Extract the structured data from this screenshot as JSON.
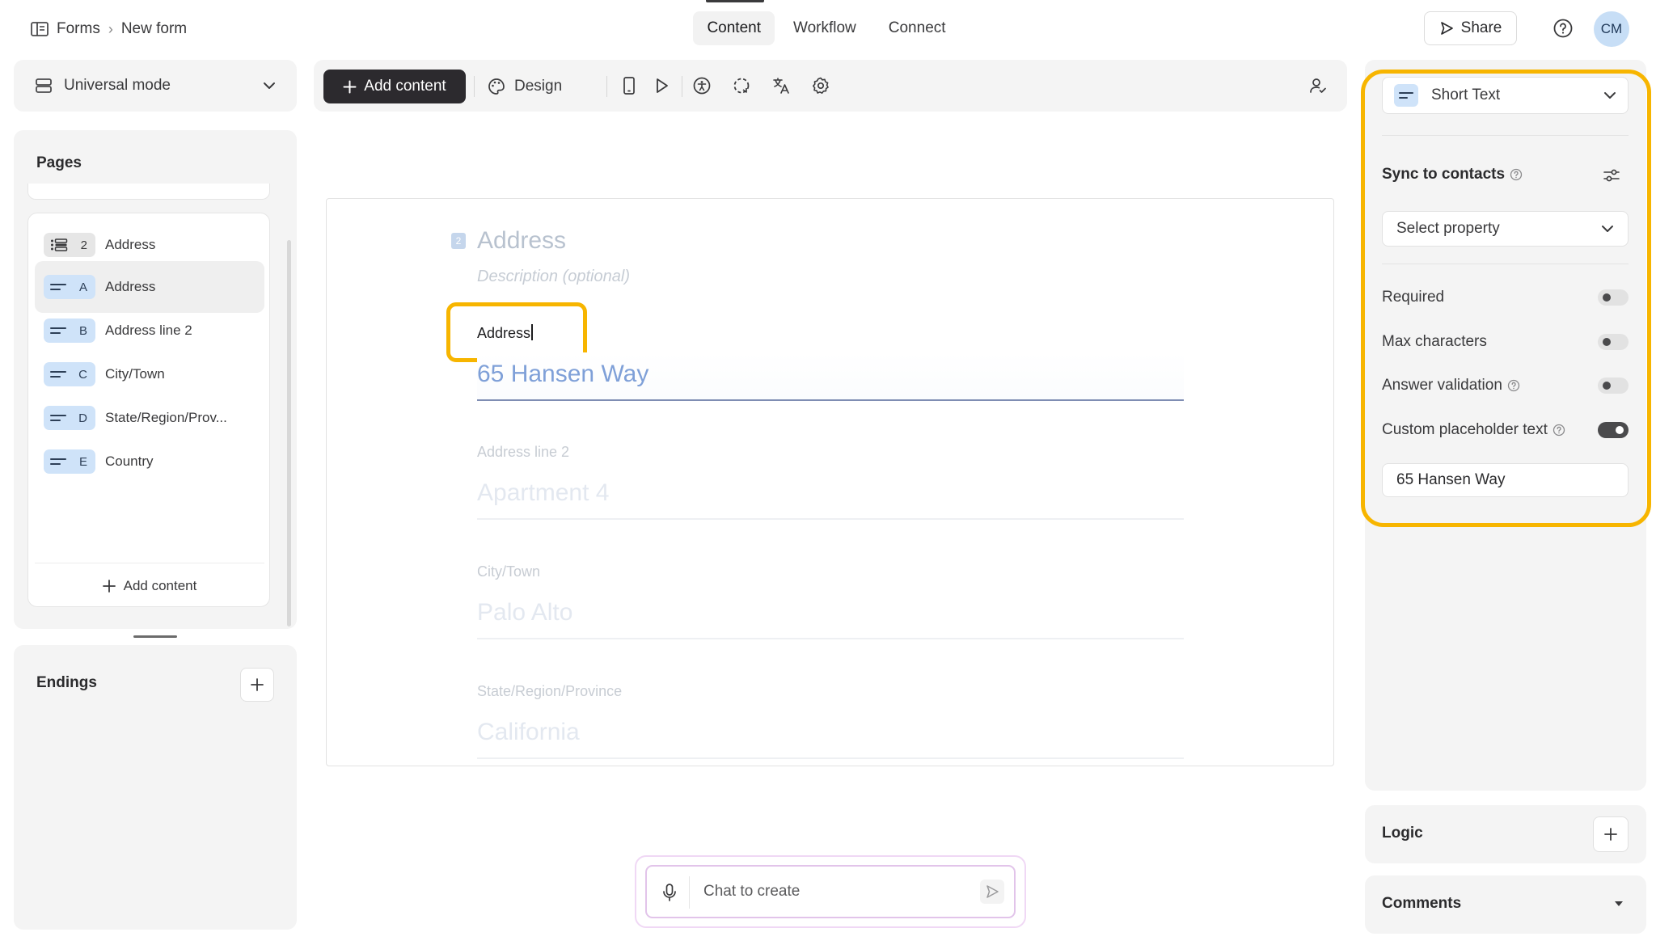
{
  "header": {
    "breadcrumb": {
      "root": "Forms",
      "current": "New form"
    },
    "tabs": [
      {
        "label": "Content",
        "active": true
      },
      {
        "label": "Workflow",
        "active": false
      },
      {
        "label": "Connect",
        "active": false
      }
    ],
    "share_label": "Share",
    "avatar_initials": "CM"
  },
  "left": {
    "mode_label": "Universal mode",
    "pages_title": "Pages",
    "items": [
      {
        "badge": "2",
        "label": "Address",
        "type": "group",
        "selected": false
      },
      {
        "badge": "A",
        "label": "Address",
        "type": "short-text",
        "selected": true
      },
      {
        "badge": "B",
        "label": "Address line 2",
        "type": "short-text",
        "selected": false
      },
      {
        "badge": "C",
        "label": "City/Town",
        "type": "short-text",
        "selected": false
      },
      {
        "badge": "D",
        "label": "State/Region/Prov...",
        "type": "short-text",
        "selected": false
      },
      {
        "badge": "E",
        "label": "Country",
        "type": "short-text",
        "selected": false
      }
    ],
    "add_content_label": "Add content",
    "endings_title": "Endings"
  },
  "toolbar": {
    "add_content_label": "Add content",
    "design_label": "Design"
  },
  "canvas": {
    "question_number": "2",
    "question_title": "Address",
    "description_placeholder": "Description (optional)",
    "fields": [
      {
        "label": "Address",
        "placeholder": "65 Hansen Way"
      },
      {
        "label": "Address line 2",
        "placeholder": "Apartment 4"
      },
      {
        "label": "City/Town",
        "placeholder": "Palo Alto"
      },
      {
        "label": "State/Region/Province",
        "placeholder": "California"
      }
    ]
  },
  "chat": {
    "placeholder": "Chat to create"
  },
  "settings": {
    "question_type": "Short Text",
    "sync_title": "Sync to contacts",
    "property_placeholder": "Select property",
    "rows": [
      {
        "label": "Required",
        "on": false,
        "help": false
      },
      {
        "label": "Max characters",
        "on": false,
        "help": false
      },
      {
        "label": "Answer validation",
        "on": false,
        "help": true
      },
      {
        "label": "Custom placeholder text",
        "on": true,
        "help": true
      }
    ],
    "placeholder_value": "65 Hansen Way",
    "logic_title": "Logic",
    "comments_title": "Comments"
  },
  "colors": {
    "highlight": "#f7b500",
    "dark_button": "#2c2a2e",
    "chip_blue": "#cfe3f9",
    "panel_bg": "#f4f4f4"
  }
}
